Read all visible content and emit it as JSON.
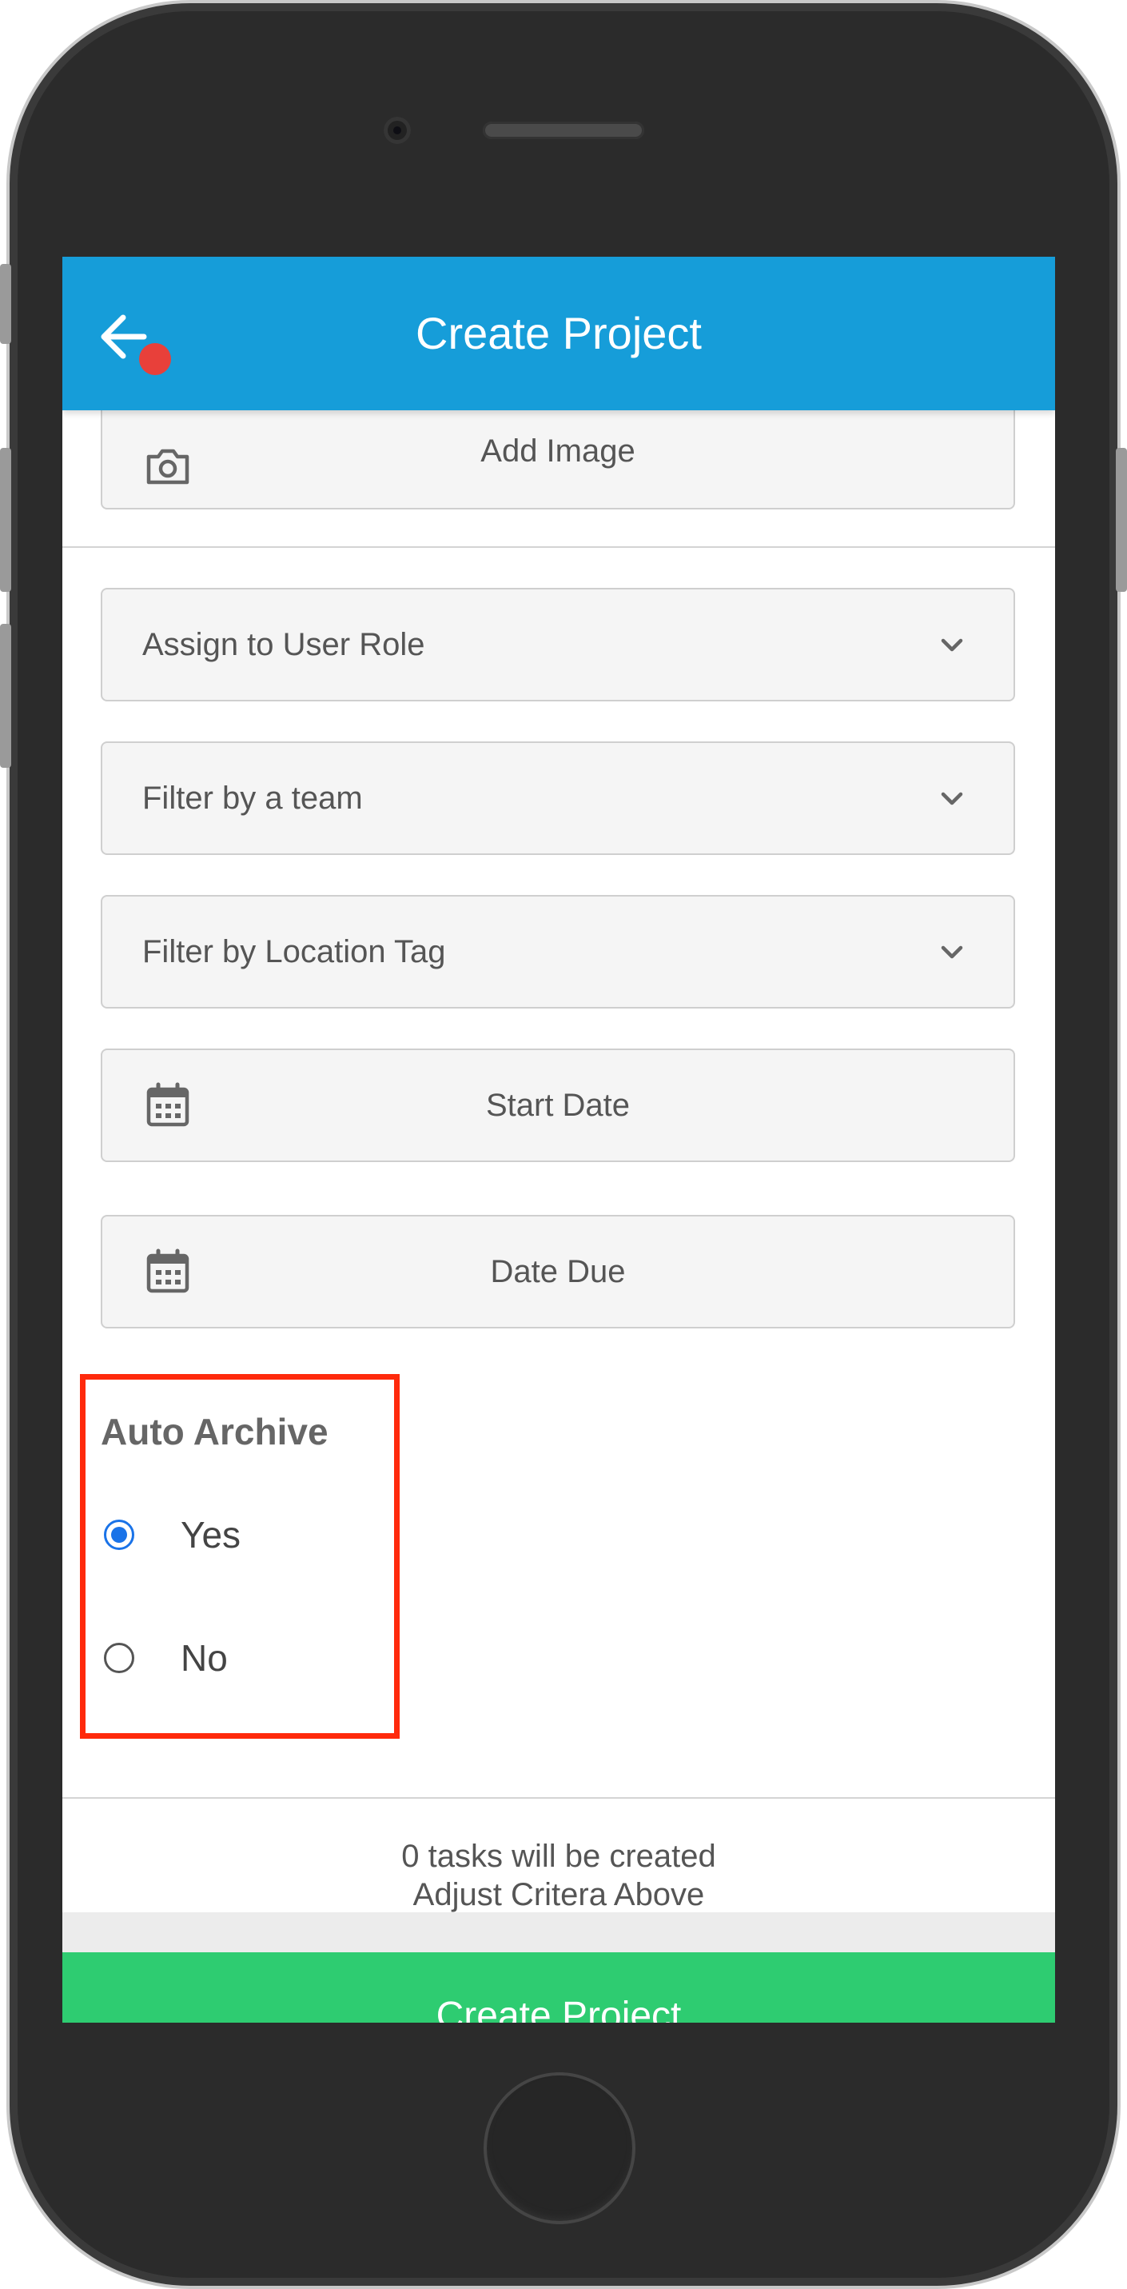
{
  "header": {
    "title": "Create Project"
  },
  "form": {
    "add_image_label": "Add Image",
    "user_role_placeholder": "Assign to User Role",
    "team_placeholder": "Filter by a team",
    "location_placeholder": "Filter by Location Tag",
    "start_date_label": "Start Date",
    "due_date_label": "Date Due"
  },
  "auto_archive": {
    "title": "Auto Archive",
    "options": [
      {
        "label": "Yes",
        "selected": true
      },
      {
        "label": "No",
        "selected": false
      }
    ]
  },
  "summary": {
    "tasks_line": "0 tasks will be created",
    "hint_line": "Adjust Critera Above"
  },
  "footer": {
    "create_label": "Create Project"
  },
  "colors": {
    "header_bg": "#169dd9",
    "create_button_bg": "#2ecc71",
    "highlight_border": "#ff2a0c",
    "radio_selected": "#1a73e8",
    "notification_dot": "#e8403a"
  }
}
